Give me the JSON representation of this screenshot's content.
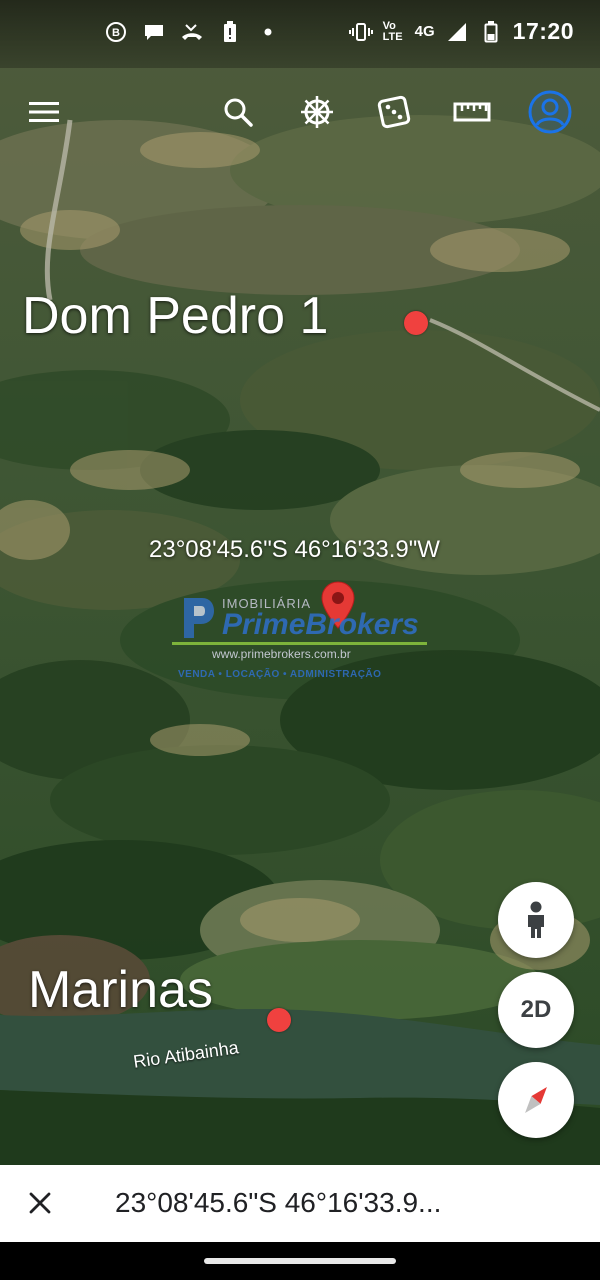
{
  "status_bar": {
    "time": "17:20",
    "network": "4G",
    "volte": "Vo LTE",
    "left_icons": [
      "b-chat-icon",
      "chat-bubble-icon",
      "missed-call-icon",
      "battery-alert-icon",
      "dot-icon"
    ],
    "right_icons": [
      "vibrate-icon",
      "volte-icon",
      "signal-icon",
      "battery-icon"
    ]
  },
  "toolbar": {
    "icons": [
      "menu-icon",
      "search-icon",
      "voyager-wheel-icon",
      "dice-icon",
      "ruler-icon",
      "account-icon"
    ],
    "accent_color": "#1a73e8"
  },
  "map": {
    "places": [
      {
        "name": "Dom Pedro 1"
      },
      {
        "name": "Marinas"
      }
    ],
    "river_label": "Rio Atibainha",
    "pin_coordinates": "23°08'45.6\"S 46°16'33.9\"W",
    "pin_color": "#e53935",
    "watermark": {
      "small": "IMOBILIÁRIA",
      "brand": "PrimeBrokers",
      "url": "www.primebrokers.com.br",
      "tagline": "VENDA • LOCAÇÃO • ADMINISTRAÇÃO"
    }
  },
  "fabs": {
    "pegman_icon": "pegman-icon",
    "view_mode": "2D",
    "compass_icon": "compass-icon"
  },
  "bottom_bar": {
    "coordinates": "23°08'45.6\"S 46°16'33.9..."
  }
}
